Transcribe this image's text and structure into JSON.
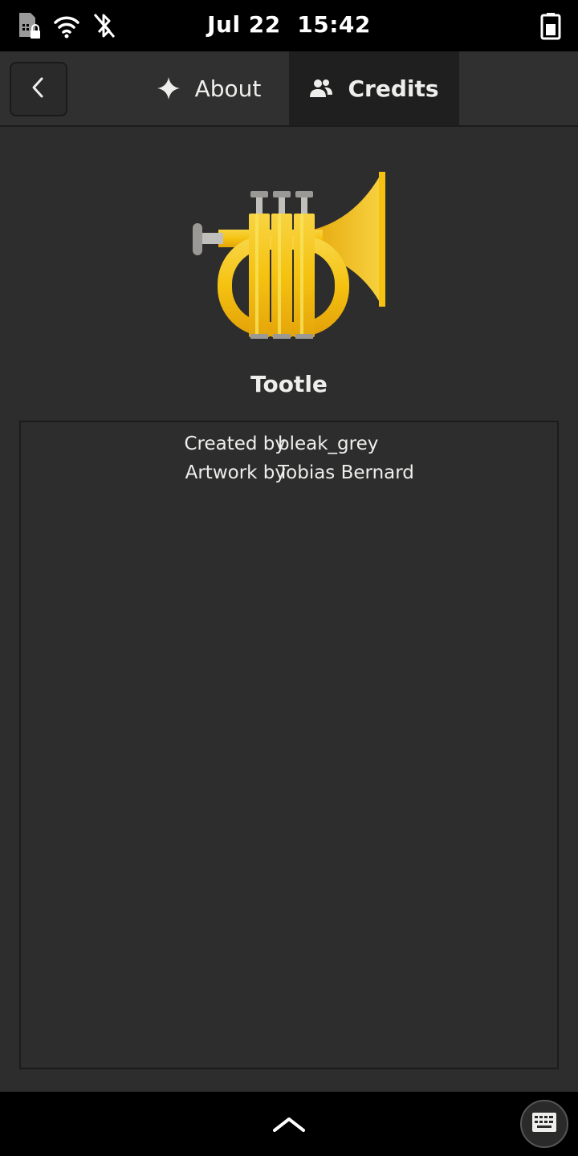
{
  "status_bar": {
    "date": "Jul 22",
    "time": "15:42",
    "icons": [
      "sim-locked-icon",
      "wifi-icon",
      "bluetooth-disabled-icon",
      "battery-icon"
    ]
  },
  "header": {
    "back_icon": "chevron-left-icon",
    "tabs": [
      {
        "label": "About",
        "icon": "sparkle-icon",
        "active": false
      },
      {
        "label": "Credits",
        "icon": "people-icon",
        "active": true
      }
    ]
  },
  "app": {
    "name": "Tootle",
    "icon": "trumpet-icon"
  },
  "credits": [
    {
      "label": "Created by",
      "value": "bleak_grey"
    },
    {
      "label": "Artwork by",
      "value": "Tobias Bernard"
    }
  ],
  "bottom_bar": {
    "home_icon": "chevron-up-icon",
    "keyboard_icon": "keyboard-icon"
  },
  "colors": {
    "background": "#2d2d2d",
    "header": "#303030",
    "active_tab": "#1f1f1f",
    "trumpet_gold": "#f5c211"
  }
}
